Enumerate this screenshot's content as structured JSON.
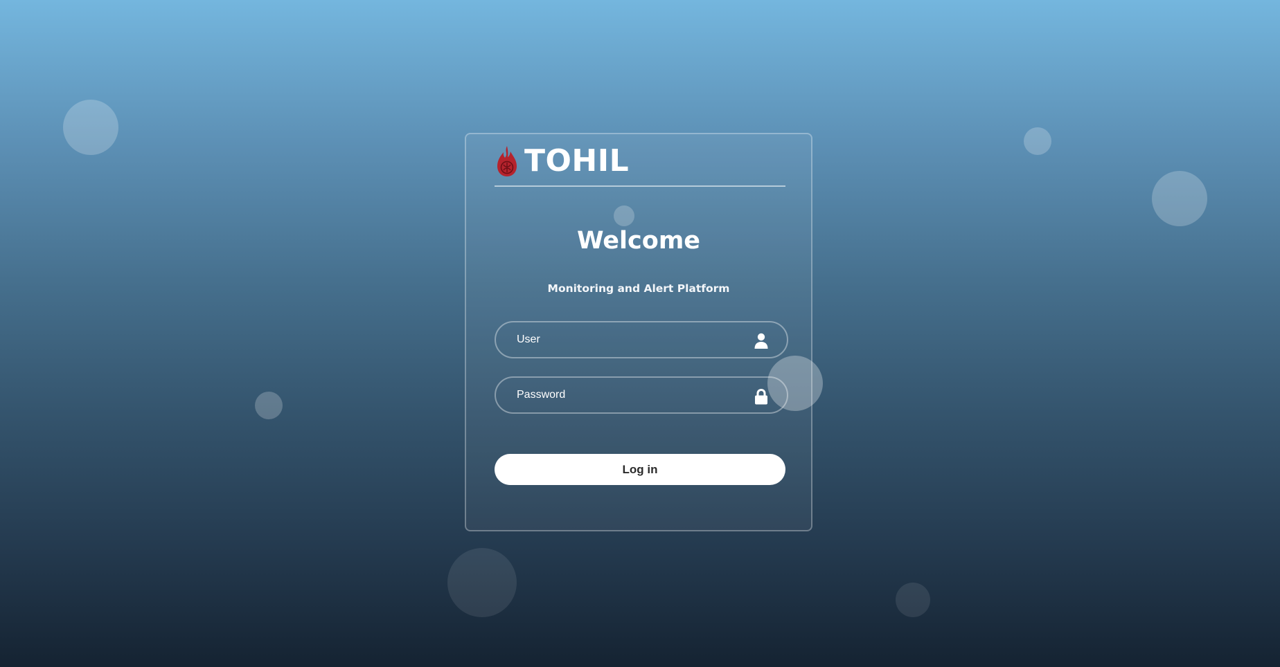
{
  "brand": {
    "name": "TOHIL",
    "logo_icon": "flame-logo",
    "logo_color": "#b5232d"
  },
  "welcome": {
    "title": "Welcome",
    "subtitle": "Monitoring and Alert Platform"
  },
  "form": {
    "user_placeholder": "User",
    "user_icon": "user-icon",
    "password_placeholder": "Password",
    "password_icon": "lock-icon",
    "login_label": "Log in"
  },
  "colors": {
    "background_top": "#74b6de",
    "background_bottom": "#152332",
    "button_bg": "#ffffff",
    "button_text": "#2a2a2a"
  }
}
